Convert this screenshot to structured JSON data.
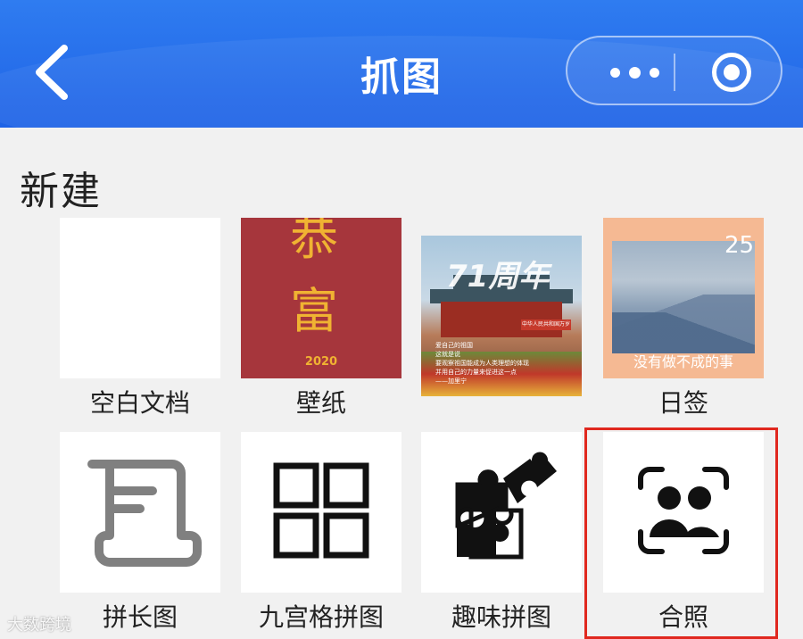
{
  "header": {
    "title": "抓图",
    "back_icon": "chevron-left-icon",
    "more_icon": "more-dots-icon",
    "close_icon": "target-circle-icon",
    "background_color": "#2a72ee"
  },
  "section": {
    "title": "新建"
  },
  "templates": [
    {
      "label": "空白文档",
      "thumb": "blank"
    },
    {
      "label": "壁纸",
      "thumb": "wallpaper",
      "lines": [
        "恭",
        "富"
      ],
      "year": "2020"
    },
    {
      "label": "",
      "thumb": "poster",
      "headline": "71周年",
      "plaque": "中华人民共和国万岁",
      "text_lines": [
        "爱自己的祖国",
        "这就是说",
        "要观察祖国能成为人类理想的体现",
        "并用自己的力量来促进这一点",
        "——加里宁"
      ]
    },
    {
      "label": "日签",
      "thumb": "calendar",
      "day": "25",
      "quote": "没有做不成的事"
    },
    {
      "label": "拼长图",
      "thumb": "long-image-icon"
    },
    {
      "label": "九宫格拼图",
      "thumb": "grid-icon"
    },
    {
      "label": "趣味拼图",
      "thumb": "puzzle-icon"
    },
    {
      "label": "合照",
      "thumb": "group-photo-icon",
      "highlighted": true
    }
  ],
  "highlight_color": "#e0281f",
  "watermark": "大数跨境"
}
